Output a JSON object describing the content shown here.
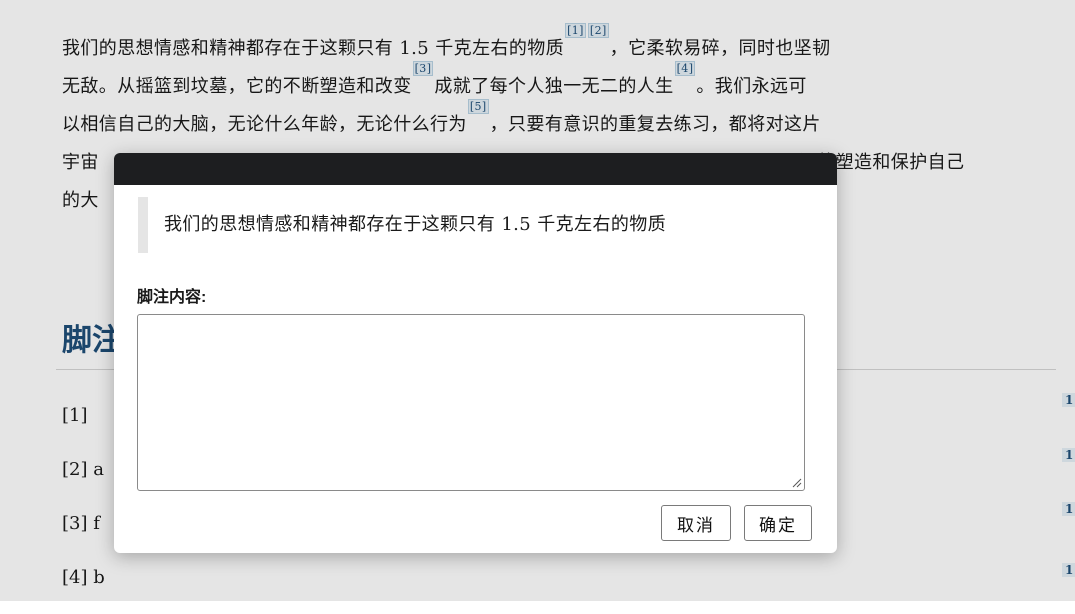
{
  "article": {
    "line1": {
      "a": "我们的思想情感和精神都存在于这颗只有 1.5 千克左右的物质",
      "fn1": "[1]",
      "fn2": "[2]",
      "b": "，它柔软易碎，同时也坚韧"
    },
    "line2": {
      "a": "无敌。从摇篮到坟墓，它的不断塑造和改变",
      "fn3": "[3]",
      "b": "成就了每个人独一无二的人生",
      "fn4": "[4]",
      "c": "。我们永远可"
    },
    "line3": {
      "a": "以相信自己的大脑，无论什么年龄，无论什么行为",
      "fn5": "[5]",
      "b": "，只要有意识的重复去练习，都将对这片"
    },
    "line4": {
      "a": "宇宙",
      "b": "识的塑造和保护自己"
    },
    "line5": {
      "a": "的大"
    }
  },
  "footnotes": {
    "title": "脚注",
    "items": [
      {
        "label": "[1]",
        "text": "",
        "backref": "1"
      },
      {
        "label": "[2] a",
        "text": "",
        "backref": "1"
      },
      {
        "label": "[3] f",
        "text": "",
        "backref": "1"
      },
      {
        "label": "[4] b",
        "text": "",
        "backref": "1"
      }
    ]
  },
  "dialog": {
    "quote": "我们的思想情感和精神都存在于这颗只有 1.5 千克左右的物质",
    "field_label": "脚注内容:",
    "textarea_value": "",
    "cancel_label": "取消",
    "ok_label": "确定"
  },
  "colors": {
    "accent": "#1f4e79",
    "dialog_header": "#1d1e20"
  }
}
